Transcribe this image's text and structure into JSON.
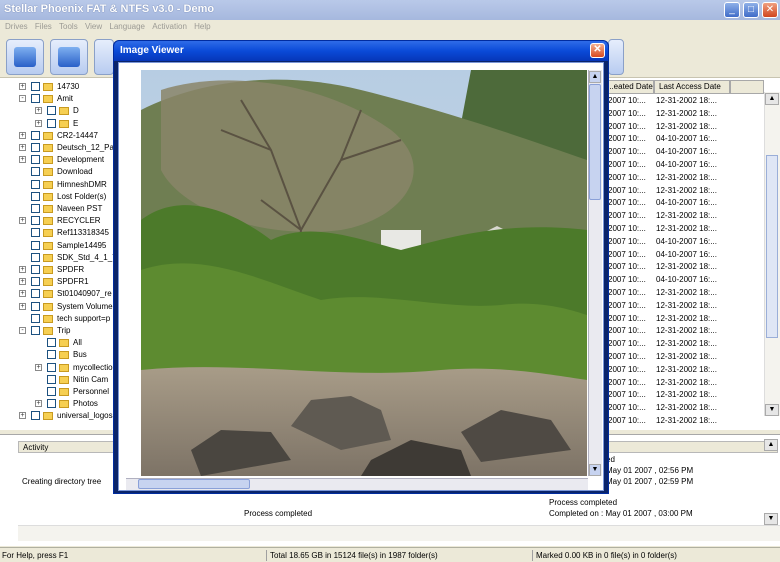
{
  "app": {
    "title": "Stellar Phoenix FAT & NTFS v3.0 - Demo"
  },
  "menu": [
    "Drives",
    "Files",
    "Tools",
    "View",
    "Language",
    "Activation",
    "Help"
  ],
  "tree": [
    {
      "label": "14730",
      "level": 0,
      "expander": "+"
    },
    {
      "label": "Amit",
      "level": 0,
      "expander": "-"
    },
    {
      "label": "D",
      "level": 1,
      "expander": "+"
    },
    {
      "label": "E",
      "level": 1,
      "expander": "+"
    },
    {
      "label": "CR2-14447",
      "level": 0,
      "expander": "+"
    },
    {
      "label": "Deutsch_12_Pa",
      "level": 0,
      "expander": "+"
    },
    {
      "label": "Development",
      "level": 0,
      "expander": "+"
    },
    {
      "label": "Download",
      "level": 0,
      "expander": ""
    },
    {
      "label": "HimneshDMR",
      "level": 0,
      "expander": ""
    },
    {
      "label": "Lost Folder(s)",
      "level": 0,
      "expander": ""
    },
    {
      "label": "Naveen PST",
      "level": 0,
      "expander": ""
    },
    {
      "label": "RECYCLER",
      "level": 0,
      "expander": "+"
    },
    {
      "label": "Ref113318345",
      "level": 0,
      "expander": ""
    },
    {
      "label": "Sample14495",
      "level": 0,
      "expander": ""
    },
    {
      "label": "SDK_Std_4_1_7",
      "level": 0,
      "expander": ""
    },
    {
      "label": "SPDFR",
      "level": 0,
      "expander": "+"
    },
    {
      "label": "SPDFR1",
      "level": 0,
      "expander": "+"
    },
    {
      "label": "St01040907_re",
      "level": 0,
      "expander": "+"
    },
    {
      "label": "System Volume",
      "level": 0,
      "expander": "+"
    },
    {
      "label": "tech support=p",
      "level": 0,
      "expander": ""
    },
    {
      "label": "Trip",
      "level": 0,
      "expander": "-"
    },
    {
      "label": "All",
      "level": 1,
      "expander": ""
    },
    {
      "label": "Bus",
      "level": 1,
      "expander": ""
    },
    {
      "label": "mycollection",
      "level": 1,
      "expander": "+"
    },
    {
      "label": "Nitin Cam",
      "level": 1,
      "expander": ""
    },
    {
      "label": "Personnel",
      "level": 1,
      "expander": ""
    },
    {
      "label": "Photos",
      "level": 1,
      "expander": "+"
    },
    {
      "label": "universal_logos",
      "level": 0,
      "expander": "+"
    }
  ],
  "list": {
    "headers": [
      "...eated Date",
      "Last Access Date"
    ],
    "rows": [
      [
        "2007 10:...",
        "12-31-2002 18:..."
      ],
      [
        "2007 10:...",
        "12-31-2002 18:..."
      ],
      [
        "2007 10:...",
        "12-31-2002 18:..."
      ],
      [
        "2007 10:...",
        "04-10-2007 16:..."
      ],
      [
        "2007 10:...",
        "04-10-2007 16:..."
      ],
      [
        "2007 10:...",
        "04-10-2007 16:..."
      ],
      [
        "2007 10:...",
        "12-31-2002 18:..."
      ],
      [
        "2007 10:...",
        "12-31-2002 18:..."
      ],
      [
        "2007 10:...",
        "04-10-2007 16:..."
      ],
      [
        "2007 10:...",
        "12-31-2002 18:..."
      ],
      [
        "2007 10:...",
        "12-31-2002 18:..."
      ],
      [
        "2007 10:...",
        "04-10-2007 16:..."
      ],
      [
        "2007 10:...",
        "04-10-2007 16:..."
      ],
      [
        "2007 10:...",
        "12-31-2002 18:..."
      ],
      [
        "2007 10:...",
        "04-10-2007 16:..."
      ],
      [
        "2007 10:...",
        "12-31-2002 18:..."
      ],
      [
        "2007 10:...",
        "12-31-2002 18:..."
      ],
      [
        "2007 10:...",
        "12-31-2002 18:..."
      ],
      [
        "2007 10:...",
        "12-31-2002 18:..."
      ],
      [
        "2007 10:...",
        "12-31-2002 18:..."
      ],
      [
        "2007 10:...",
        "12-31-2002 18:..."
      ],
      [
        "2007 10:...",
        "12-31-2002 18:..."
      ],
      [
        "2007 10:...",
        "12-31-2002 18:..."
      ],
      [
        "2007 10:...",
        "12-31-2002 18:..."
      ],
      [
        "2007 10:...",
        "12-31-2002 18:..."
      ],
      [
        "2007 10:...",
        "12-31-2002 18:..."
      ]
    ]
  },
  "activity": {
    "header": "Activity",
    "status_left": "Creating directory tree",
    "process_center": "Process completed",
    "lines_right": [
      "ed",
      "May 01 2007 , 02:56 PM",
      "May 01 2007 , 02:59 PM",
      "Process completed",
      "Completed on : May 01 2007 , 03:00 PM"
    ]
  },
  "statusbar": {
    "help": "For Help, press F1",
    "total": "Total 18.65 GB in 15124 file(s) in 1987 folder(s)",
    "marked": "Marked 0.00 KB in 0 file(s) in 0 folder(s)"
  },
  "dialog": {
    "title": "Image Viewer",
    "close_glyph": "✕"
  },
  "glyphs": {
    "minimize": "_",
    "maximize": "□",
    "close": "✕",
    "up": "▲",
    "down": "▼"
  }
}
